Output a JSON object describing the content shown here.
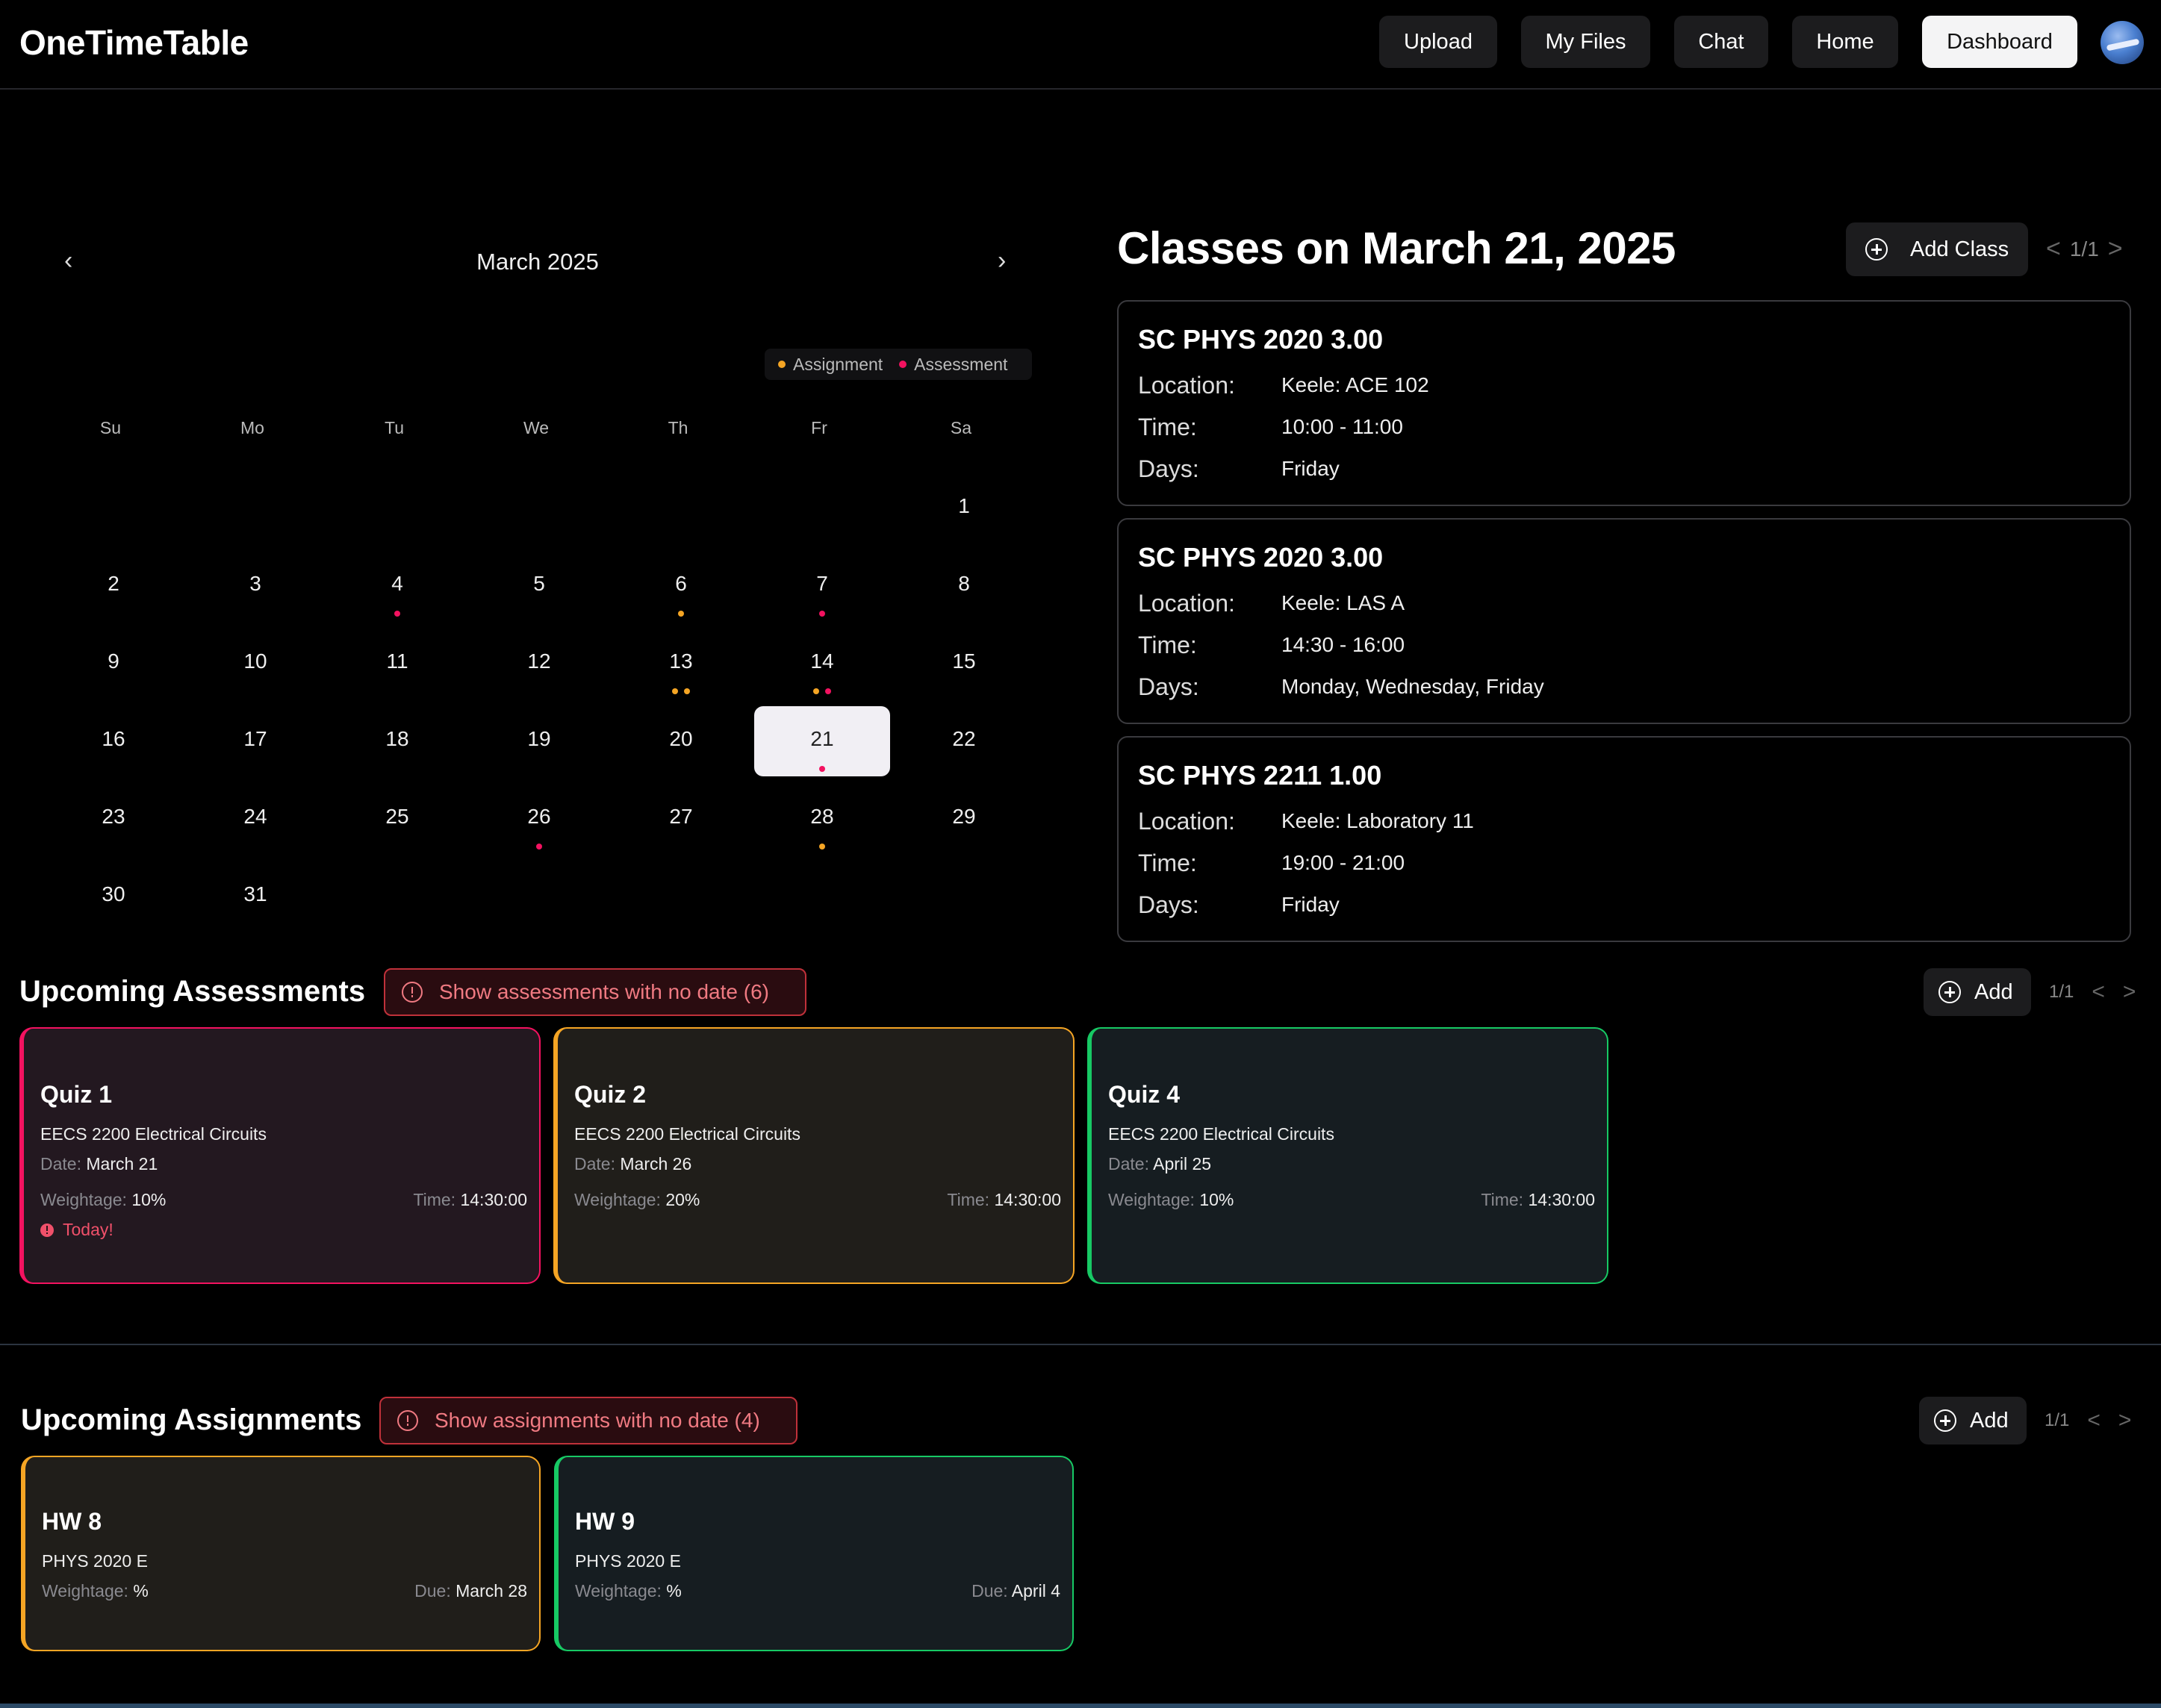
{
  "app": {
    "title": "OneTimeTable"
  },
  "nav": {
    "upload": "Upload",
    "my_files": "My Files",
    "chat": "Chat",
    "home": "Home",
    "dashboard": "Dashboard"
  },
  "calendar": {
    "month_label": "March 2025",
    "prev": "‹",
    "next": "›",
    "legend": {
      "assignment": "Assignment",
      "assessment": "Assessment"
    },
    "weekdays": [
      "Su",
      "Mo",
      "Tu",
      "We",
      "Th",
      "Fr",
      "Sa"
    ],
    "days": [
      "1",
      "2",
      "3",
      "4",
      "5",
      "6",
      "7",
      "8",
      "9",
      "10",
      "11",
      "12",
      "13",
      "14",
      "15",
      "16",
      "17",
      "18",
      "19",
      "20",
      "21",
      "22",
      "23",
      "24",
      "25",
      "26",
      "27",
      "28",
      "29",
      "30",
      "31"
    ],
    "selected_day": "21"
  },
  "colors": {
    "assignment": "#f5a524",
    "assessment": "#f31260",
    "future": "#17c964"
  },
  "classes": {
    "title": "Classes on March 21, 2025",
    "add_label": "Add Class",
    "page": "1/1",
    "prev": "<",
    "next": ">",
    "labels": {
      "location": "Location:",
      "time": "Time:",
      "days": "Days:"
    },
    "items": [
      {
        "title": "SC PHYS 2020 3.00",
        "location": "Keele: ACE 102",
        "time": "10:00 - 11:00",
        "days": "Friday"
      },
      {
        "title": "SC PHYS 2020 3.00",
        "location": "Keele: LAS A",
        "time": "14:30 - 16:00",
        "days": "Monday, Wednesday, Friday"
      },
      {
        "title": "SC PHYS 2211 1.00",
        "location": "Keele: Laboratory 11",
        "time": "19:00 - 21:00",
        "days": "Friday"
      }
    ]
  },
  "assessments": {
    "title": "Upcoming Assessments",
    "no_date_label": "Show assessments with no date (6)",
    "add_label": "Add",
    "page": "1/1",
    "prev": "<",
    "next": ">",
    "labels": {
      "date": "Date:",
      "weightage": "Weightage:",
      "time": "Time:"
    },
    "items": [
      {
        "title": "Quiz 1",
        "course": "EECS 2200 Electrical Circuits",
        "date": "March 21",
        "weightage": "10%",
        "time": "14:30:00",
        "note": "Today!"
      },
      {
        "title": "Quiz 2",
        "course": "EECS 2200 Electrical Circuits",
        "date": "March 26",
        "weightage": "20%",
        "time": "14:30:00"
      },
      {
        "title": "Quiz 4",
        "course": "EECS 2200 Electrical Circuits",
        "date": "April 25",
        "weightage": "10%",
        "time": "14:30:00"
      }
    ]
  },
  "assignments": {
    "title": "Upcoming Assignments",
    "no_date_label": "Show assignments with no date (4)",
    "add_label": "Add",
    "page": "1/1",
    "prev": "<",
    "next": ">",
    "labels": {
      "weightage": "Weightage:",
      "due": "Due:"
    },
    "items": [
      {
        "title": "HW 8",
        "course": "PHYS 2020 E",
        "weightage": "%",
        "due": "March 28"
      },
      {
        "title": "HW 9",
        "course": "PHYS 2020 E",
        "weightage": "%",
        "due": "April 4"
      }
    ]
  }
}
